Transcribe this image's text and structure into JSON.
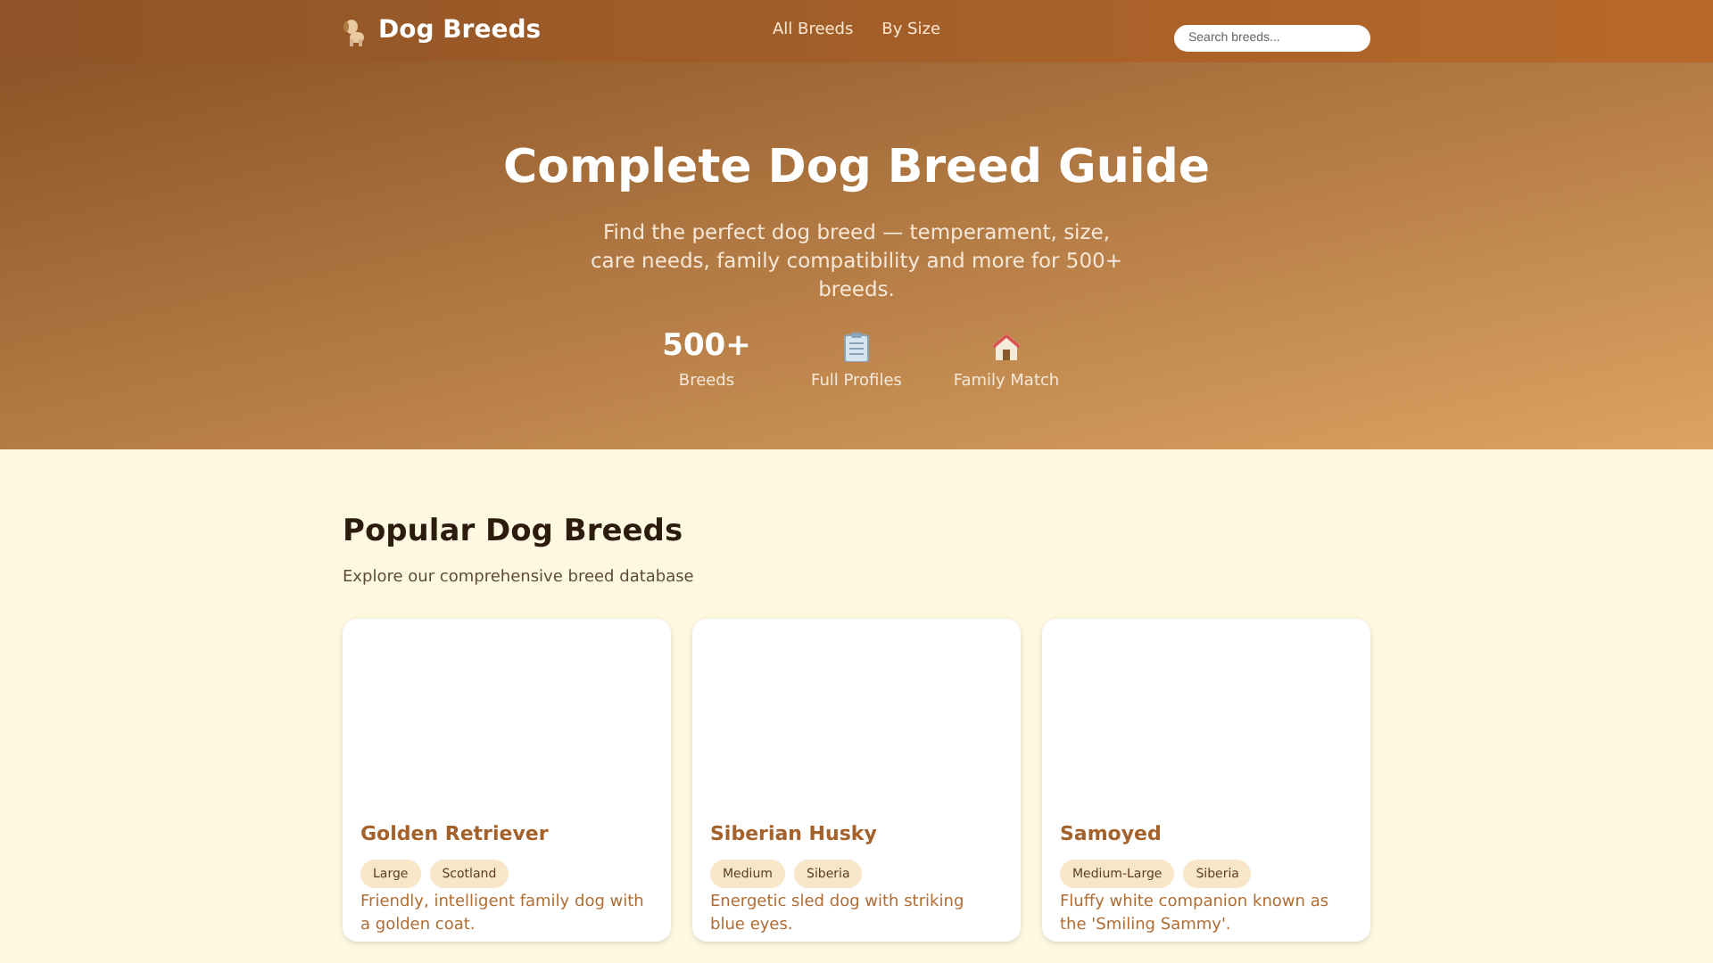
{
  "header": {
    "logo": "Dog Breeds",
    "nav": [
      {
        "label": "All Breeds"
      },
      {
        "label": "By Size"
      }
    ],
    "search": {
      "placeholder": "Search breeds..."
    }
  },
  "hero": {
    "title": "Complete Dog Breed Guide",
    "subtitle": "Find the perfect dog breed — temperament, size, care needs, family compatibility and more for 500+ breeds.",
    "stats": [
      {
        "kind": "number",
        "value": "500+",
        "label": "Breeds"
      },
      {
        "kind": "clipboard",
        "label": "Full Profiles"
      },
      {
        "kind": "house",
        "label": "Family Match"
      }
    ]
  },
  "section": {
    "title": "Popular Dog Breeds",
    "subtitle": "Explore our comprehensive breed database",
    "cards": [
      {
        "name": "Golden Retriever",
        "tags": [
          "Large",
          "Scotland"
        ],
        "description": "Friendly, intelligent family dog with a golden coat."
      },
      {
        "name": "Siberian Husky",
        "tags": [
          "Medium",
          "Siberia"
        ],
        "description": "Energetic sled dog with striking blue eyes."
      },
      {
        "name": "Samoyed",
        "tags": [
          "Medium-Large",
          "Siberia"
        ],
        "description": "Fluffy white companion known as the 'Smiling Sammy'."
      }
    ]
  }
}
